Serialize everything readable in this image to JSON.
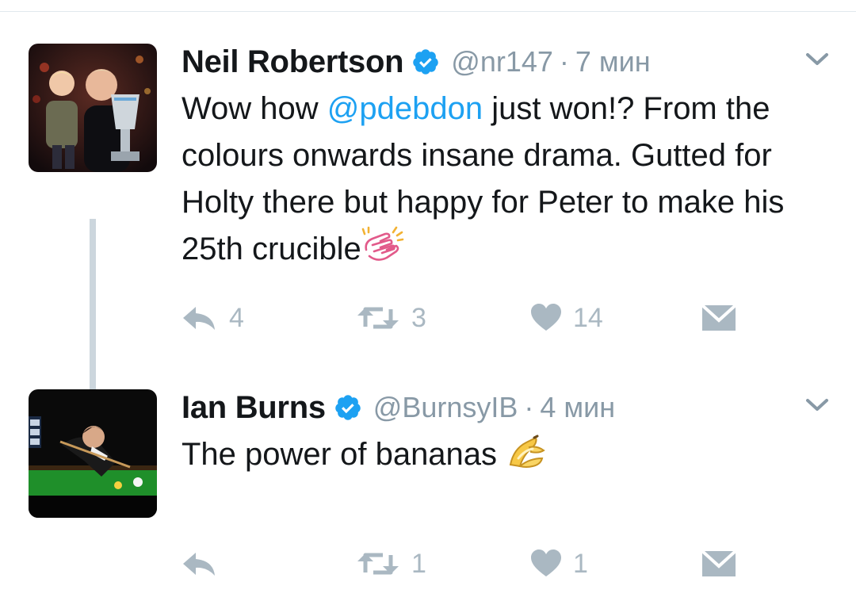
{
  "colors": {
    "accent": "#1da1f2",
    "icon_gray": "#aab8c2",
    "meta_gray": "#8899a6",
    "thread_line": "#ccd6dd"
  },
  "tweets": [
    {
      "author": {
        "name": "Neil Robertson",
        "handle": "@nr147",
        "verified": true,
        "avatar_icon": "avatar-photo-trophy"
      },
      "separator": "·",
      "time": "7 мин",
      "text": {
        "part1": "Wow how ",
        "mention": "@pdebdon",
        "part2": " just won!? From the colours onwards insane drama. Gutted for Holty there but happy for Peter to make his 25th crucible",
        "emoji": "clapping-hands-icon"
      },
      "actions": {
        "reply_count": "4",
        "retweet_count": "3",
        "like_count": "14"
      }
    },
    {
      "author": {
        "name": "Ian Burns",
        "handle": "@BurnsyIB",
        "verified": true,
        "avatar_icon": "avatar-photo-snooker"
      },
      "separator": "·",
      "time": "4 мин",
      "text": {
        "part1": "The power of bananas",
        "emoji": "banana-icon"
      },
      "actions": {
        "reply_count": "",
        "retweet_count": "1",
        "like_count": "1"
      }
    }
  ]
}
